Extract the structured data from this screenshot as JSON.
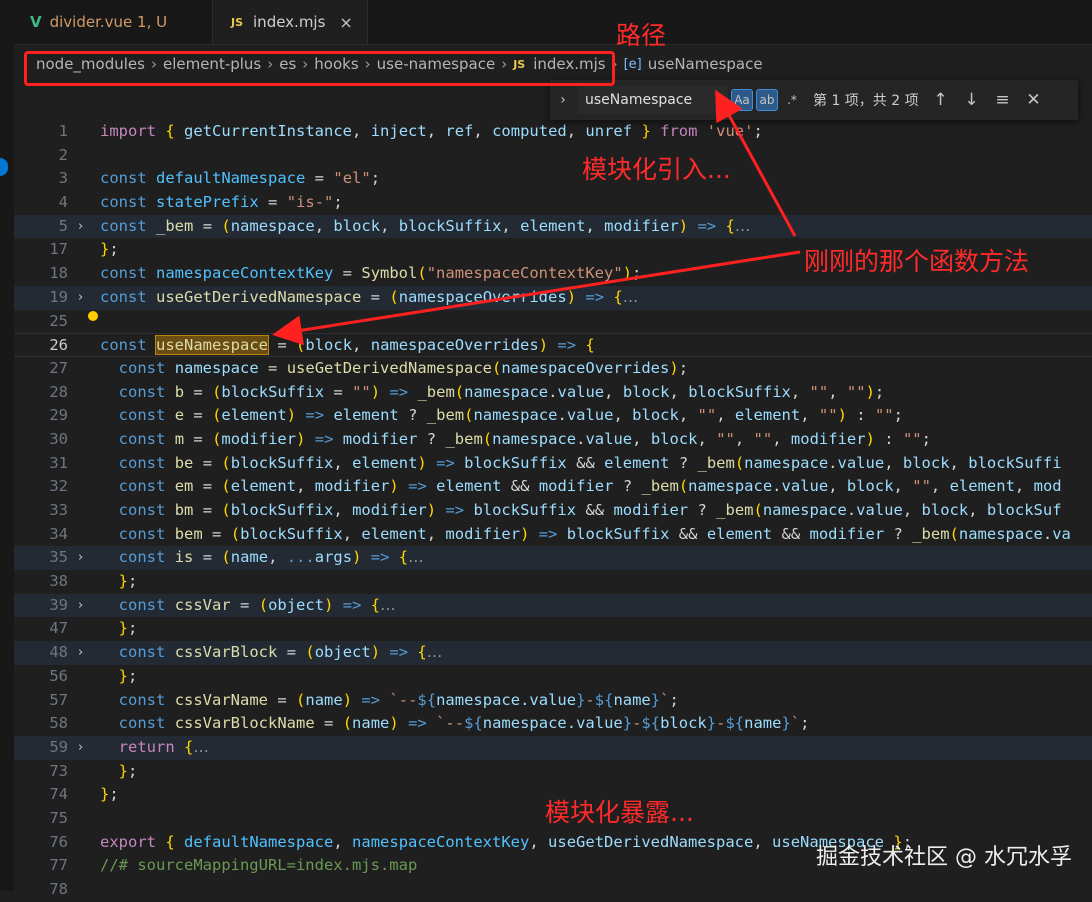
{
  "tabs": [
    {
      "name": "divider.vue",
      "status": "1, U"
    },
    {
      "name": "index.mjs",
      "close": "×"
    }
  ],
  "breadcrumb": [
    "node_modules",
    "element-plus",
    "es",
    "hooks",
    "use-namespace",
    "index.mjs",
    "useNamespace"
  ],
  "find": {
    "value": "useNamespace",
    "opt_case": "Aa",
    "opt_word": "ab",
    "opt_regex": ".*",
    "count": "第 1 项，共 2 项"
  },
  "annotations": {
    "path": "路径",
    "import": "模块化引入...",
    "fn": "刚刚的那个函数方法",
    "export": "模块化暴露..."
  },
  "code_lines": [
    {
      "n": "1",
      "t": "import { getCurrentInstance, inject, ref, computed, unref } from 'vue';"
    },
    {
      "n": "2",
      "t": ""
    },
    {
      "n": "3",
      "t": "const defaultNamespace = \"el\";"
    },
    {
      "n": "4",
      "t": "const statePrefix = \"is-\";"
    },
    {
      "n": "5",
      "t": "const _bem = (namespace, block, blockSuffix, element, modifier) => {…",
      "fold": true
    },
    {
      "n": "17",
      "t": "};"
    },
    {
      "n": "18",
      "t": "const namespaceContextKey = Symbol(\"namespaceContextKey\");"
    },
    {
      "n": "19",
      "t": "const useGetDerivedNamespace = (namespaceOverrides) => {…",
      "fold": true
    },
    {
      "n": "25",
      "t": ""
    },
    {
      "n": "26",
      "t": "const useNamespace = (block, namespaceOverrides) => {"
    },
    {
      "n": "27",
      "t": "  const namespace = useGetDerivedNamespace(namespaceOverrides);"
    },
    {
      "n": "28",
      "t": "  const b = (blockSuffix = \"\") => _bem(namespace.value, block, blockSuffix, \"\", \"\");"
    },
    {
      "n": "29",
      "t": "  const e = (element) => element ? _bem(namespace.value, block, \"\", element, \"\") : \"\";"
    },
    {
      "n": "30",
      "t": "  const m = (modifier) => modifier ? _bem(namespace.value, block, \"\", \"\", modifier) : \"\";"
    },
    {
      "n": "31",
      "t": "  const be = (blockSuffix, element) => blockSuffix && element ? _bem(namespace.value, block, blockSuffi"
    },
    {
      "n": "32",
      "t": "  const em = (element, modifier) => element && modifier ? _bem(namespace.value, block, \"\", element, mod"
    },
    {
      "n": "33",
      "t": "  const bm = (blockSuffix, modifier) => blockSuffix && modifier ? _bem(namespace.value, block, blockSuf"
    },
    {
      "n": "34",
      "t": "  const bem = (blockSuffix, element, modifier) => blockSuffix && element && modifier ? _bem(namespace.va"
    },
    {
      "n": "35",
      "t": "  const is = (name, ...args) => {…",
      "fold": true
    },
    {
      "n": "38",
      "t": "  };"
    },
    {
      "n": "39",
      "t": "  const cssVar = (object) => {…",
      "fold": true
    },
    {
      "n": "47",
      "t": "  };"
    },
    {
      "n": "48",
      "t": "  const cssVarBlock = (object) => {…",
      "fold": true
    },
    {
      "n": "56",
      "t": "  };"
    },
    {
      "n": "57",
      "t": "  const cssVarName = (name) => `--${namespace.value}-${name}`;"
    },
    {
      "n": "58",
      "t": "  const cssVarBlockName = (name) => `--${namespace.value}-${block}-${name}`;"
    },
    {
      "n": "59",
      "t": "  return {…",
      "fold": true
    },
    {
      "n": "73",
      "t": "  };"
    },
    {
      "n": "74",
      "t": "};"
    },
    {
      "n": "75",
      "t": ""
    },
    {
      "n": "76",
      "t": "export { defaultNamespace, namespaceContextKey, useGetDerivedNamespace, useNamespace };"
    },
    {
      "n": "77",
      "t": "//# sourceMappingURL=index.mjs.map"
    },
    {
      "n": "78",
      "t": ""
    }
  ],
  "watermark": "掘金技术社区 @ 水冗水孚"
}
